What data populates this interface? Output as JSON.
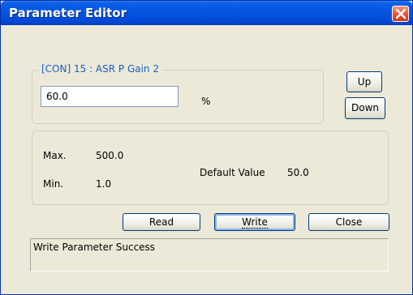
{
  "window": {
    "title": "Parameter Editor"
  },
  "parameter": {
    "legend": "[CON] 15 : ASR P Gain 2",
    "value": "60.0",
    "unit": "%",
    "up_label": "Up",
    "down_label": "Down"
  },
  "info": {
    "max_label": "Max.",
    "max_value": "500.0",
    "min_label": "Min.",
    "min_value": "1.0",
    "default_label": "Default Value",
    "default_value": "50.0"
  },
  "actions": {
    "read_label": "Read",
    "write_label": "Write",
    "close_label": "Close"
  },
  "status": {
    "message": "Write Parameter Success"
  },
  "colors": {
    "titlebar": "#0454e0",
    "close_button": "#e4593a",
    "legend_text": "#1660c6",
    "dialog_background": "#ece9d8"
  },
  "icons": {
    "close": "close-icon"
  }
}
